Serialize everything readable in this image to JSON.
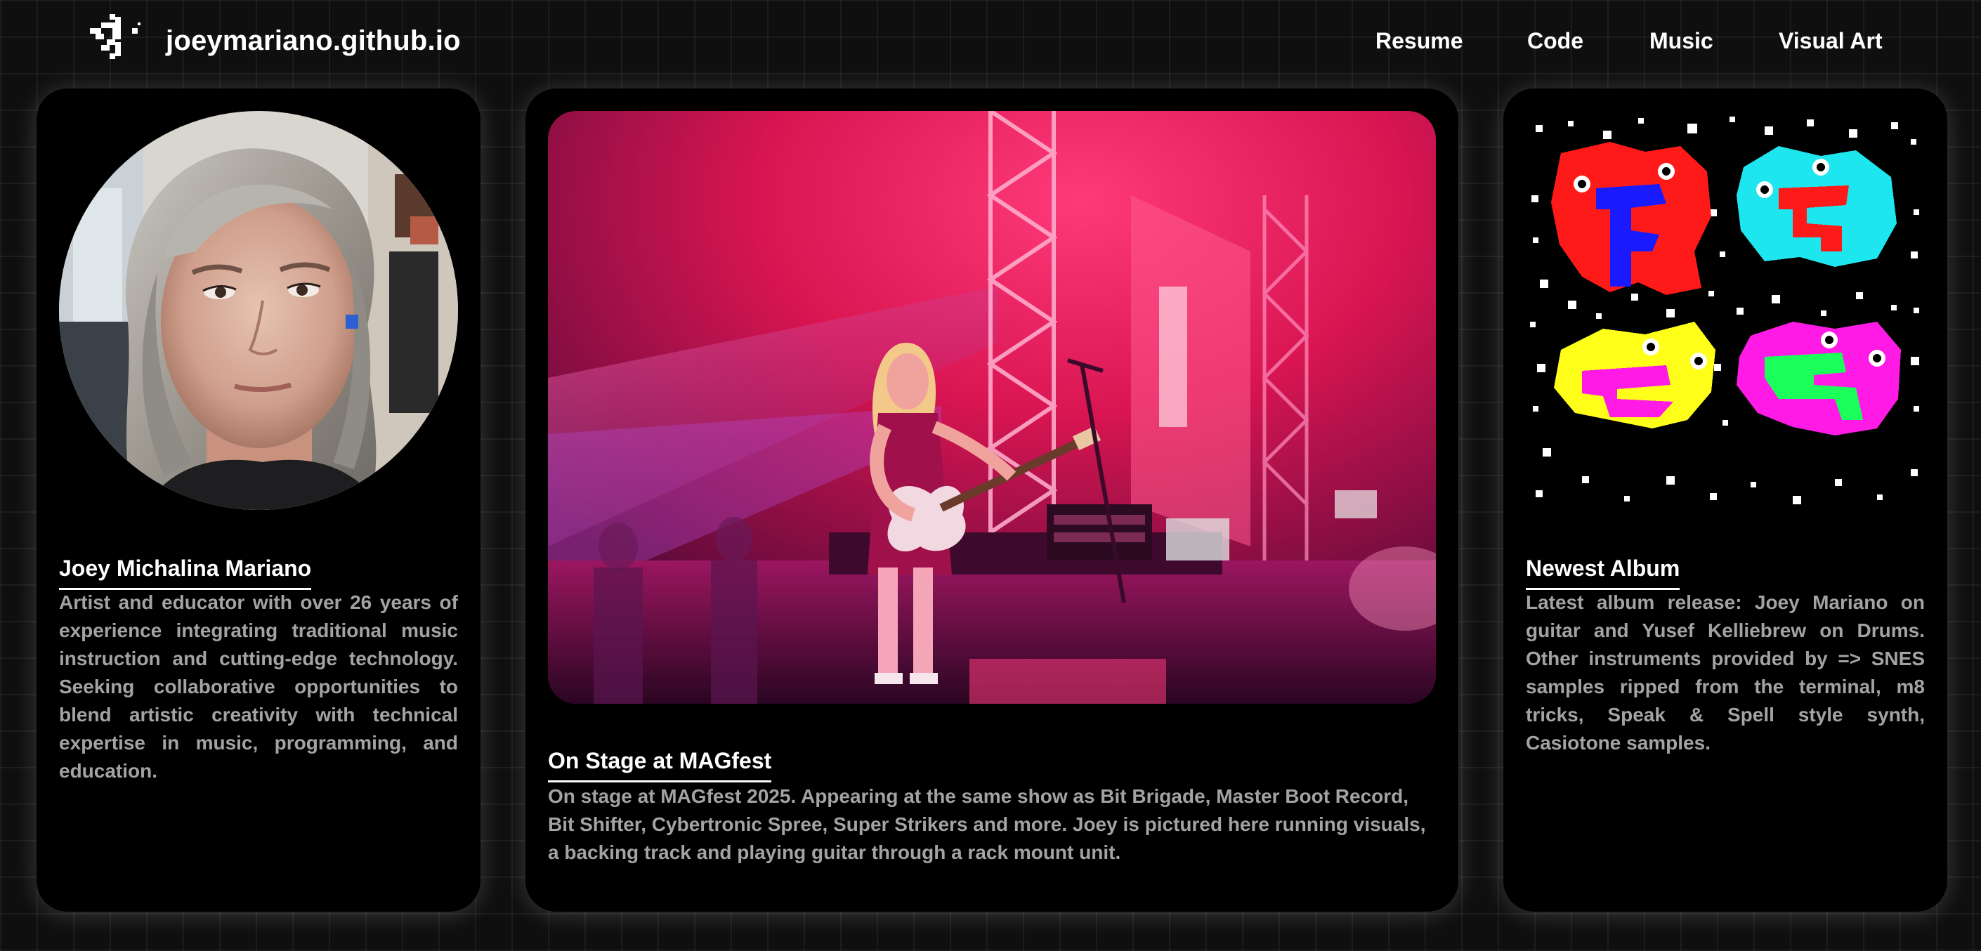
{
  "header": {
    "site_title": "joeymariano.github.io",
    "nav": [
      {
        "label": "Resume"
      },
      {
        "label": "Code"
      },
      {
        "label": "Music"
      },
      {
        "label": "Visual Art"
      }
    ]
  },
  "profile": {
    "name": "Joey Michalina Mariano",
    "bio": "Artist and educator with over 26 years of experience integrating traditional music instruction and cutting-edge technology. Seeking collaborative opportunities to blend artistic creativity with technical expertise in music, programming, and education."
  },
  "feature": {
    "title": "On Stage at MAGfest",
    "description": "On stage at MAGfest 2025. Appearing at the same show as Bit Brigade, Master Boot Record, Bit Shifter, Cybertronic Spree, Super Strikers and more. Joey is pictured here running visuals, a backing track and playing guitar through a rack mount unit."
  },
  "album": {
    "title": "Newest Album",
    "description": "Latest album release: Joey Mariano on guitar and Yusef Kelliebrew on Drums. Other instruments provided by => SNES samples ripped from the terminal, m8 tricks, Speak & Spell style synth, Casiotone samples."
  },
  "colors": {
    "background": "#0f0f0f",
    "card": "#000000",
    "text": "#ffffff",
    "muted_text": "#a3a3a3",
    "stage_magenta": "#e0185c",
    "blob_red": "#ff1a1a",
    "blob_cyan": "#1ee6ee",
    "blob_yellow": "#ffff1a",
    "blob_magenta": "#ff1ae6",
    "blob_blue": "#1a1aff",
    "blob_green": "#1aff5a"
  },
  "icons": {
    "logo": "pixel-figure-logo-icon"
  }
}
